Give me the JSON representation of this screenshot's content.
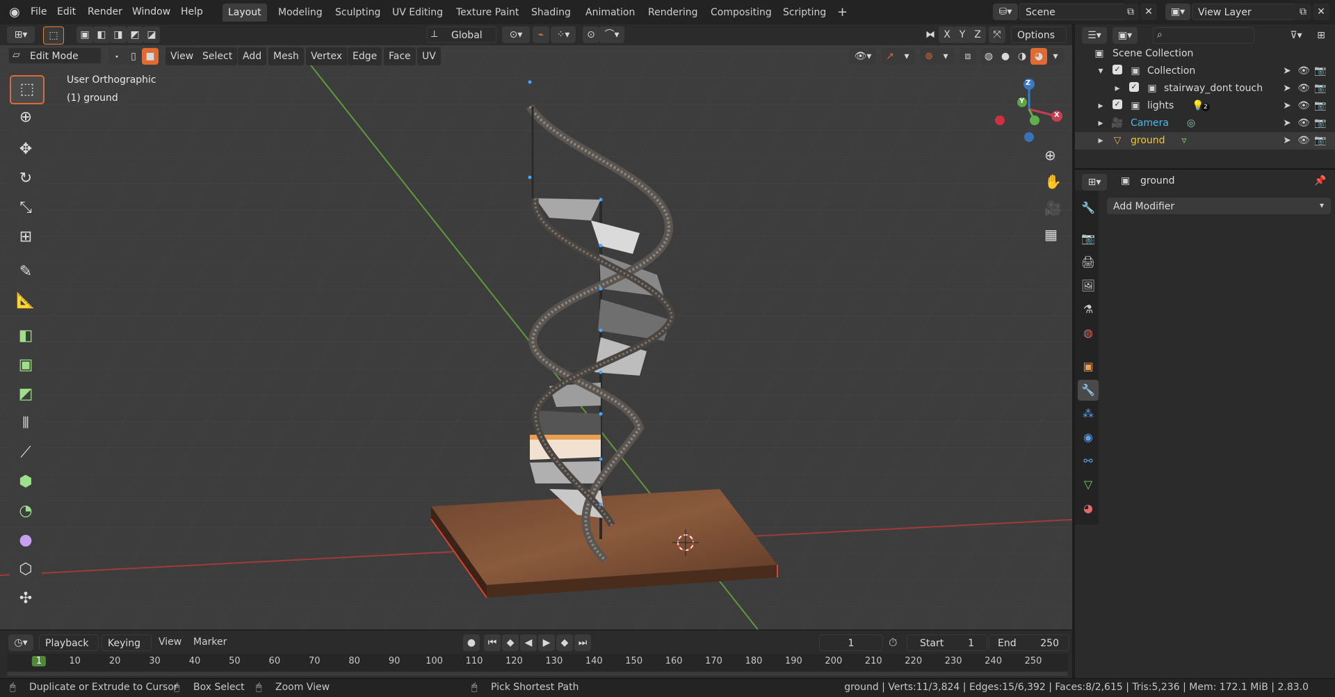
{
  "app": {
    "menus": [
      "File",
      "Edit",
      "Render",
      "Window",
      "Help"
    ],
    "workspace_tabs": [
      "Layout",
      "Modeling",
      "Sculpting",
      "UV Editing",
      "Texture Paint",
      "Shading",
      "Animation",
      "Rendering",
      "Compositing",
      "Scripting"
    ],
    "active_tab": "Layout",
    "add_tab_symbol": "+",
    "scene_name": "Scene",
    "view_layer": "View Layer"
  },
  "tool_header": {
    "orientation": "Global",
    "axis_x": "X",
    "axis_y": "Y",
    "axis_z": "Z",
    "options_label": "Options"
  },
  "viewport_header": {
    "mode": "Edit Mode",
    "menus": [
      "View",
      "Select",
      "Add",
      "Mesh",
      "Vertex",
      "Edge",
      "Face",
      "UV"
    ]
  },
  "viewport": {
    "view_name": "User Orthographic",
    "object_label": "(1) ground",
    "gizmo_x": "X",
    "gizmo_y": "Y",
    "gizmo_z": "Z"
  },
  "toolbar_tools": [
    "select-box",
    "cursor",
    "move",
    "rotate",
    "scale",
    "transform",
    "annotate",
    "measure",
    "extrude-region",
    "inset-faces",
    "bevel",
    "loop-cut",
    "knife",
    "poly-build",
    "spin",
    "smooth",
    "edge-slide",
    "shrink-fatten"
  ],
  "outliner": {
    "root": "Scene Collection",
    "items": [
      {
        "name": "Collection",
        "kind": "collection",
        "checked": true
      },
      {
        "name": "stairway_dont touch",
        "kind": "collection",
        "checked": true
      },
      {
        "name": "lights",
        "kind": "collection",
        "checked": true,
        "badge": "2"
      },
      {
        "name": "Camera",
        "kind": "camera",
        "color": "#4fb6e8"
      },
      {
        "name": "ground",
        "kind": "mesh",
        "color": "#f0c640"
      }
    ]
  },
  "properties": {
    "object_name": "ground",
    "add_modifier": "Add Modifier"
  },
  "timeline": {
    "menus": [
      "Playback",
      "Keying",
      "View",
      "Marker"
    ],
    "current_frame": "1",
    "start_label": "Start",
    "start_value": "1",
    "end_label": "End",
    "end_value": "250",
    "ticks": [
      "1",
      "10",
      "20",
      "30",
      "40",
      "50",
      "60",
      "70",
      "80",
      "90",
      "100",
      "110",
      "120",
      "130",
      "140",
      "150",
      "160",
      "170",
      "180",
      "190",
      "200",
      "210",
      "220",
      "230",
      "240",
      "250"
    ]
  },
  "statusbar": {
    "hint1": "Duplicate or Extrude to Cursor",
    "hint2": "Box Select",
    "hint3": "Zoom View",
    "hint4": "Pick Shortest Path",
    "stats": "ground | Verts:11/3,824 | Edges:15/6,392 | Faces:8/2,615 | Tris:5,236 | Mem: 172.1 MiB | 2.83.0"
  },
  "colors": {
    "accent": "#5a7fbd",
    "ground_wood": "#8a5a3a",
    "axis_red": "#a23a3a",
    "axis_green": "#5f9a3a",
    "selection_orange": "#e8803a"
  }
}
